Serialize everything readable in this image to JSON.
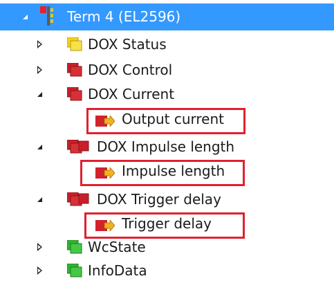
{
  "tree": {
    "root": {
      "label": "Term 4 (EL2596)",
      "icon": "terminal-icon",
      "expanded": true,
      "selected": true
    },
    "items": [
      {
        "label": "DOX Status",
        "icon": "input-variables-folder-icon",
        "color": "#f2d31c",
        "expanded": false
      },
      {
        "label": "DOX Control",
        "icon": "output-variables-folder-icon",
        "color": "#c8202a",
        "expanded": false
      },
      {
        "label": "DOX Current",
        "icon": "output-variables-folder-icon",
        "color": "#c8202a",
        "expanded": true,
        "children": [
          {
            "label": "Output current",
            "icon": "output-variable-icon",
            "highlighted": true
          }
        ]
      },
      {
        "label": "DOX Impulse length",
        "icon": "output-variables-folder-icon",
        "color": "#c8202a",
        "expanded": true,
        "children": [
          {
            "label": "Impulse length",
            "icon": "output-variable-icon",
            "highlighted": true
          }
        ]
      },
      {
        "label": "DOX Trigger delay",
        "icon": "output-variables-folder-icon",
        "color": "#c8202a",
        "expanded": true,
        "children": [
          {
            "label": "Trigger delay",
            "icon": "output-variable-icon",
            "highlighted": true
          }
        ]
      },
      {
        "label": "WcState",
        "icon": "status-variables-folder-icon",
        "color": "#2fb52f",
        "expanded": false
      },
      {
        "label": "InfoData",
        "icon": "status-variables-folder-icon",
        "color": "#2fb52f",
        "expanded": false
      }
    ]
  },
  "colors": {
    "selection": "#3399ff",
    "highlight": "#e0202e"
  }
}
